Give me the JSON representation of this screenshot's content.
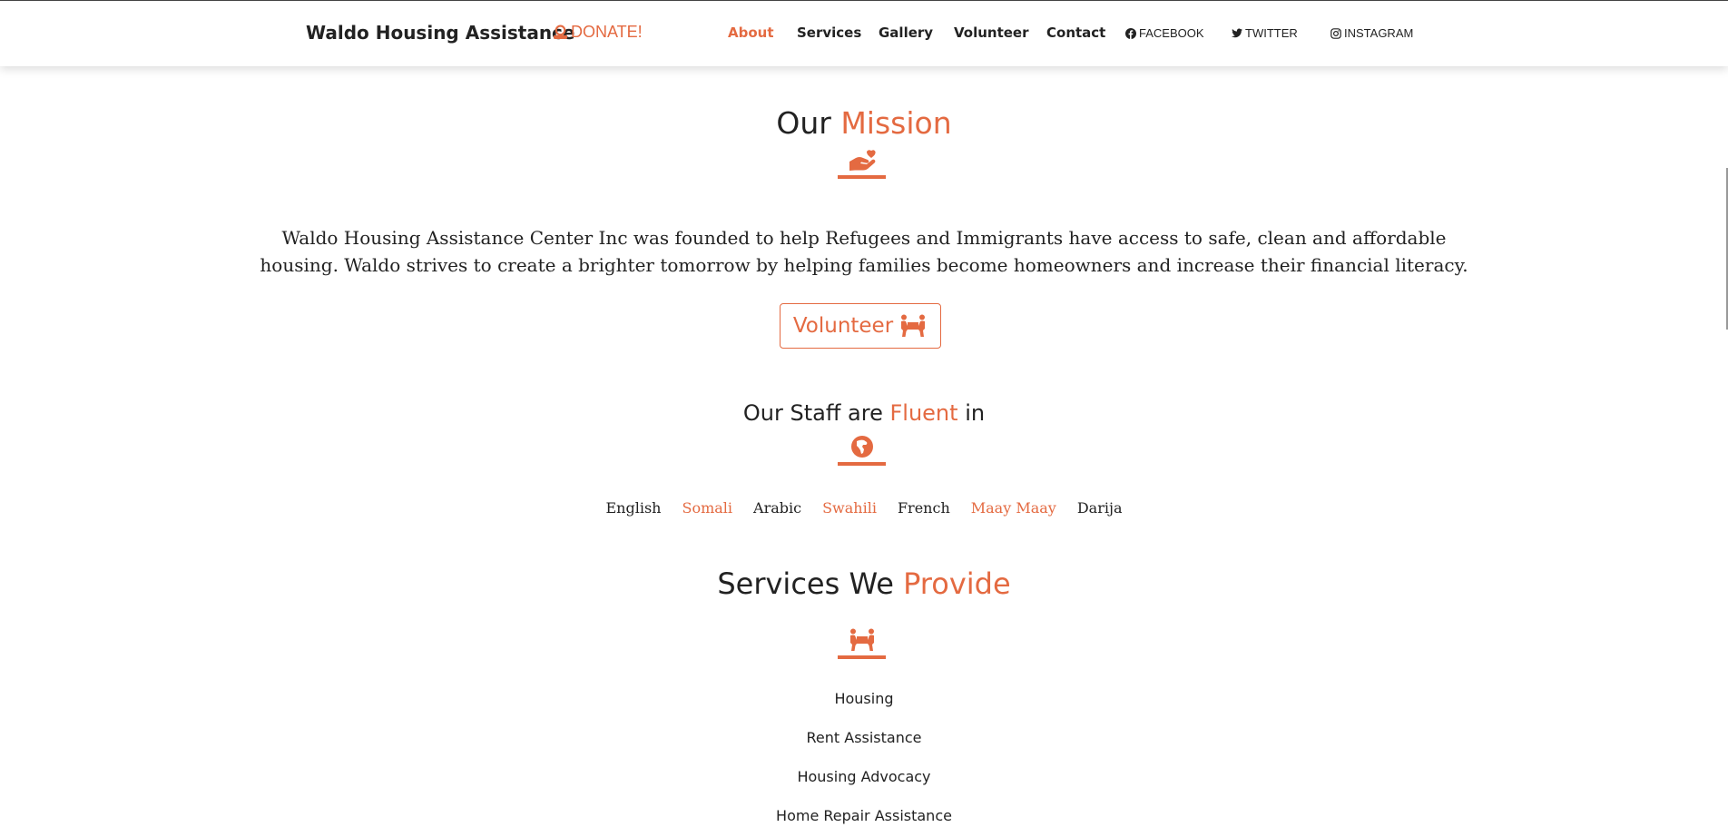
{
  "header": {
    "brand": "Waldo Housing Assistance",
    "donate_label": "DONATE!",
    "nav": [
      {
        "label": "About",
        "active": true
      },
      {
        "label": "Services"
      },
      {
        "label": "Gallery"
      },
      {
        "label": "Volunteer"
      },
      {
        "label": "Contact"
      }
    ],
    "social": [
      {
        "label": "FACEBOOK",
        "icon": "facebook-icon"
      },
      {
        "label": "TWITTER",
        "icon": "twitter-icon"
      },
      {
        "label": "INSTAGRAM",
        "icon": "instagram-icon"
      }
    ]
  },
  "mission": {
    "title_plain": "Our",
    "title_accent": "Mission",
    "icon": "hand-holding-heart-icon",
    "text": "Waldo Housing Assistance Center Inc was founded to help Refugees and Immigrants have access to safe, clean and affordable housing. Waldo strives to create a brighter tomorrow by helping families become homeowners and increase their financial literacy.",
    "button_label": "Volunteer",
    "button_icon": "people-carry-icon"
  },
  "languages": {
    "title_before": "Our Staff are",
    "title_accent": "Fluent",
    "title_after": "in",
    "icon": "globe-africa-icon",
    "items": [
      "English",
      "Somali",
      "Arabic",
      "Swahili",
      "French",
      "Maay Maay",
      "Darija"
    ]
  },
  "services": {
    "title_plain": "Services We",
    "title_accent": "Provide",
    "icon": "people-carry-icon",
    "items": [
      "Housing",
      "Rent Assistance",
      "Housing Advocacy",
      "Home Repair Assistance"
    ]
  },
  "colors": {
    "accent": "#e46a41",
    "text": "#222222",
    "background": "#ffffff"
  }
}
